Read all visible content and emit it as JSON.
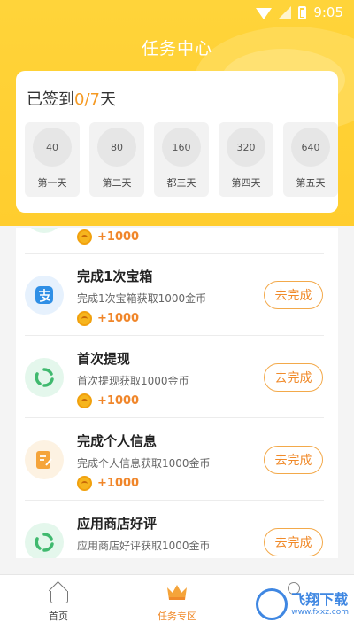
{
  "status_bar": {
    "time": "9:05"
  },
  "header": {
    "title": "任务中心"
  },
  "checkin": {
    "title_prefix": "已签到",
    "count": "0/7",
    "title_suffix": "天",
    "days": [
      {
        "coins": "40",
        "label": "第一天"
      },
      {
        "coins": "80",
        "label": "第二天"
      },
      {
        "coins": "160",
        "label": "都三天"
      },
      {
        "coins": "320",
        "label": "第四天"
      },
      {
        "coins": "640",
        "label": "第五天"
      }
    ]
  },
  "tasks": [
    {
      "name": "",
      "desc": "",
      "reward": "+1000",
      "button": ""
    },
    {
      "name": "完成1次宝箱",
      "desc": "完成1次宝箱获取1000金币",
      "reward": "+1000",
      "button": "去完成",
      "icon": "alipay-icon",
      "icon_color": "#2f8fe6",
      "icon_bg": "#e6f1fd"
    },
    {
      "name": "首次提现",
      "desc": "首次提现获取1000金币",
      "reward": "+1000",
      "button": "去完成",
      "icon": "recycle-icon",
      "icon_color": "#3fb96e",
      "icon_bg": "#e4f7ec"
    },
    {
      "name": "完成个人信息",
      "desc": "完成个人信息获取1000金币",
      "reward": "+1000",
      "button": "去完成",
      "icon": "edit-doc-icon",
      "icon_color": "#f5a43a",
      "icon_bg": "#fdf2e2"
    },
    {
      "name": "应用商店好评",
      "desc": "应用商店好评获取1000金币",
      "reward": "",
      "button": "去完成",
      "icon": "recycle-icon",
      "icon_color": "#3fb96e",
      "icon_bg": "#e4f7ec"
    }
  ],
  "bottom_nav": {
    "items": [
      {
        "label": "首页",
        "icon": "home-icon"
      },
      {
        "label": "任务专区",
        "icon": "crown-icon"
      },
      {
        "label": "",
        "icon": "profile-icon"
      }
    ]
  },
  "watermark": {
    "main": "飞翔下载",
    "sub": "www.fxxz.com"
  },
  "colors": {
    "brand_yellow": "#ffd43a",
    "accent_orange": "#f08a2a"
  }
}
